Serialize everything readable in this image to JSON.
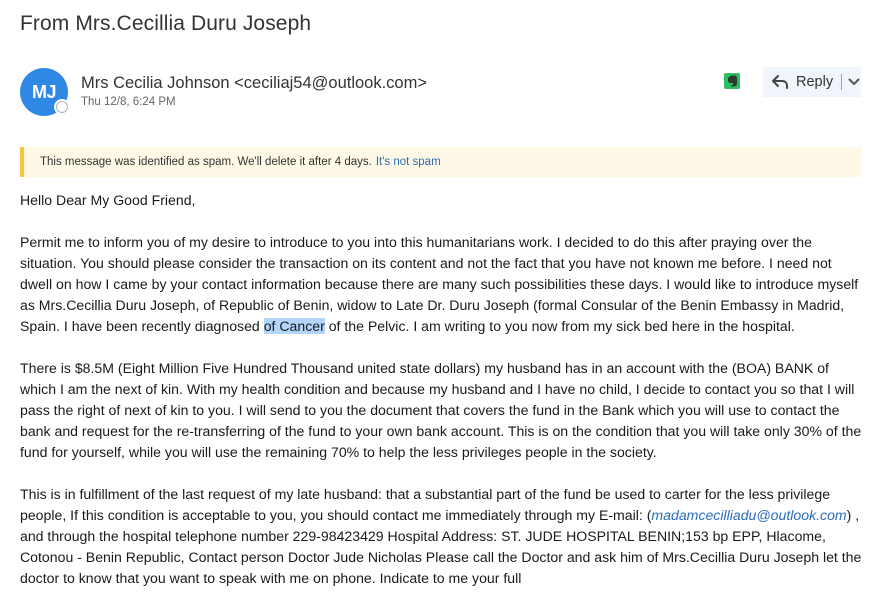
{
  "email": {
    "subject": "From Mrs.Cecillia Duru Joseph",
    "sender": {
      "initials": "MJ",
      "display": "Mrs Cecilia Johnson <ceciliaj54@outlook.com>",
      "avatar_color": "#2f88e3"
    },
    "date": "Thu 12/8, 6:24 PM",
    "actions": {
      "reply_label": "Reply"
    },
    "spam_notice": {
      "text": "This message was identified as spam. We'll delete it after 4 days.",
      "link": "It's not spam",
      "accent_color": "#f8c73e"
    },
    "body": {
      "greeting": "Hello Dear My Good Friend,",
      "p1_before": "Permit me to  inform you of my desire to introduce to you into this humanitarians work. I decided to do this after praying over the situation.  You should please consider the transaction on  its content and not the fact that you have not known me before. I need not dwell on how I came by your contact information because there are many such possibilities these days. I would like to introduce myself as Mrs.Cecillia Duru Joseph, of Republic of Benin, widow  to Late Dr. Duru Joseph   (formal Consular of the Benin Embassy in Madrid, Spain. I have been recently diagnosed ",
      "p1_highlight": "of Cancer",
      "p1_after": " of the Pelvic. I am writing to you now from my sick bed here in the hospital.",
      "p2": "There is $8.5M (Eight Million Five Hundred Thousand united state dollars) my husband has in an account with the  (BOA) BANK of which I am the next of kin. With my health condition and because my husband and I have no child, I decide to contact you so that I will pass the right of next of kin to you. I will send to you the document that covers the fund in the Bank which you will use to contact the bank and request for the re-transferring of the fund to your own bank account. This is on the condition that you will take only 30% of the fund for yourself, while you will use the remaining 70% to help the less privileges people in the society.",
      "p3_before": "This is in fulfillment of the last request of my late husband: that a substantial part of the fund be used to carter for the less privilege people, If this condition is acceptable to you, you should contact me immediately through my E-mail: (",
      "p3_email": "madamcecilliadu@outlook.com",
      "p3_after": ") , and through the hospital telephone number 229-98423429 Hospital Address: ST. JUDE  HOSPITAL BENIN;153 bp EPP,  Hlacome, Cotonou - Benin Republic, Contact person Doctor Jude Nicholas Please call the Doctor and ask him of Mrs.Cecillia Duru Joseph let the doctor to know that you want to speak with me on phone. Indicate to me your full"
    }
  }
}
